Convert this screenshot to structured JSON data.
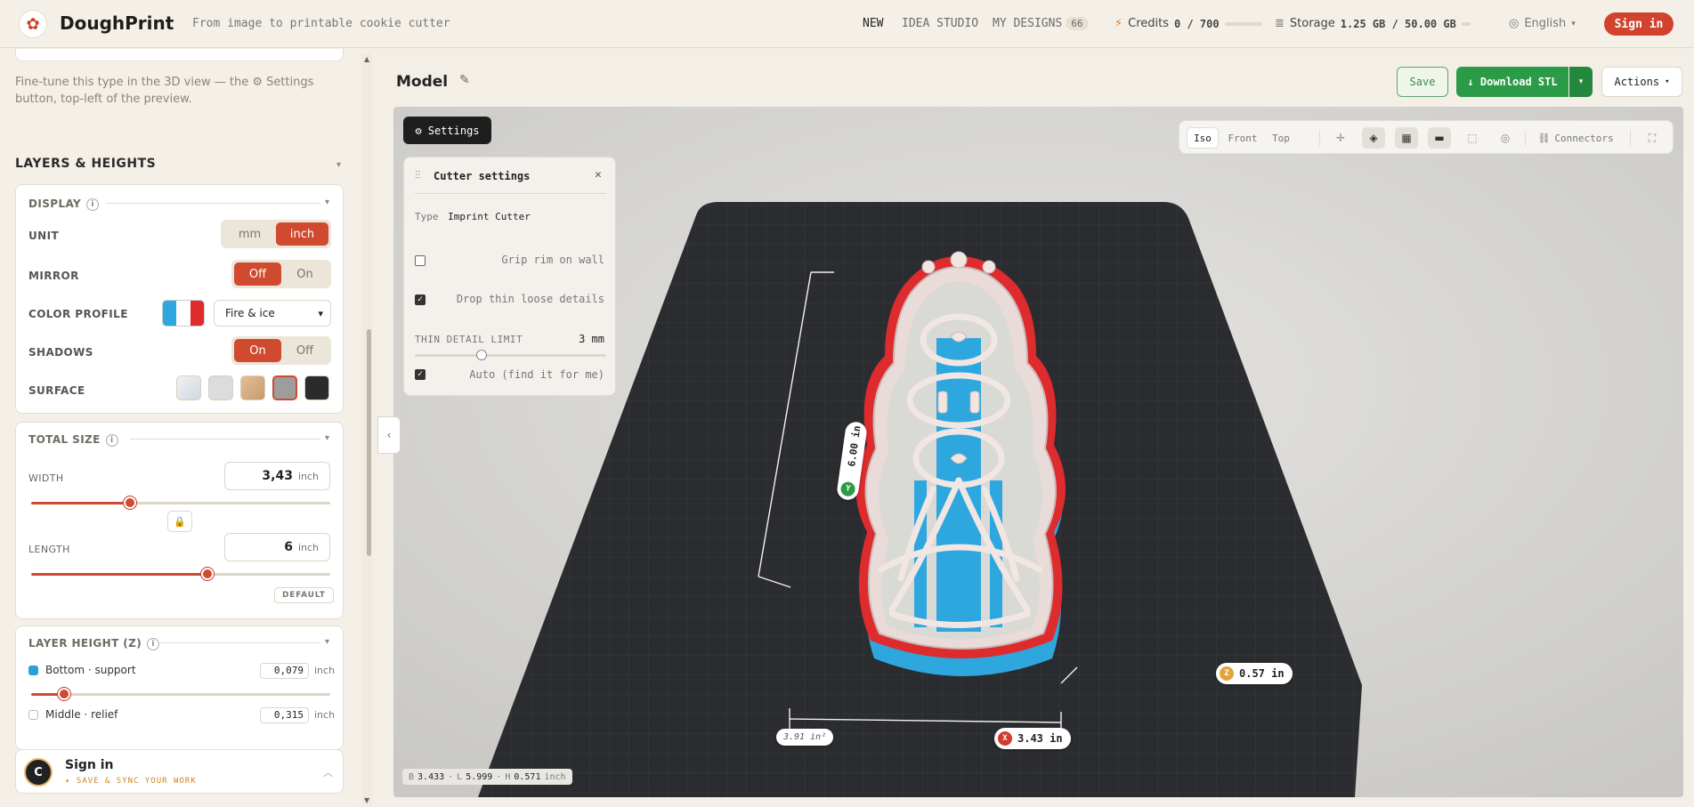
{
  "header": {
    "brand": "DoughPrint",
    "tagline": "From image to printable cookie cutter",
    "nav": [
      {
        "label": "NEW"
      },
      {
        "label": "IDEA STUDIO"
      },
      {
        "label": "MY DESIGNS",
        "count": "66"
      }
    ],
    "credits_label": "Credits",
    "credits_value": "0 / 700",
    "storage_label": "Storage",
    "storage_value": "1.25 GB / 50.00 GB",
    "language": "English",
    "signin": "Sign in"
  },
  "sidebar": {
    "hint": "Fine-tune this type in the 3D view — the ⚙ Settings button, top-left of the preview.",
    "section_title": "LAYERS & HEIGHTS",
    "display": {
      "title": "DISPLAY",
      "unit_label": "UNIT",
      "unit_options": [
        "mm",
        "inch"
      ],
      "unit_selected": "inch",
      "mirror_label": "MIRROR",
      "mirror_options": [
        "Off",
        "On"
      ],
      "mirror_selected": "Off",
      "color_profile_label": "COLOR PROFILE",
      "color_profile_value": "Fire & ice",
      "shadows_label": "SHADOWS",
      "shadows_options": [
        "On",
        "Off"
      ],
      "shadows_selected": "On",
      "surface_label": "SURFACE",
      "surface_colors": [
        "#dfe4ea",
        "#dcdcdc",
        "#d8b48e",
        "#9d9d9d",
        "#2b2b2b"
      ],
      "surface_selected_index": 3
    },
    "total_size": {
      "title": "TOTAL SIZE",
      "width_label": "WIDTH",
      "width_value": "3,43",
      "width_unit": "inch",
      "width_slider_fraction": 0.33,
      "length_label": "LENGTH",
      "length_value": "6",
      "length_unit": "inch",
      "length_slider_fraction": 0.59,
      "default_button": "DEFAULT"
    },
    "layer_height": {
      "title": "LAYER HEIGHT (Z)",
      "layers": [
        {
          "name": "Bottom · support",
          "value": "0,079",
          "unit": "inch",
          "color": "#2ba0d8",
          "checked": true,
          "slider_fraction": 0.11
        },
        {
          "name": "Middle · relief",
          "value": "0,315",
          "unit": "inch",
          "color": "#ffffff",
          "checked": false
        }
      ]
    },
    "signin_card": {
      "avatar": "C",
      "title": "Sign in",
      "subtitle": "SAVE & SYNC YOUR WORK"
    }
  },
  "main": {
    "title": "Model",
    "save": "Save",
    "download": "↓ Download STL",
    "actions": "Actions"
  },
  "viewport": {
    "settings_button": "Settings",
    "cutter_settings": {
      "title": "Cutter settings",
      "type_label": "Type",
      "type_value": "Imprint Cutter",
      "grip_rim": "Grip rim on wall",
      "grip_rim_checked": false,
      "drop_thin": "Drop thin loose details",
      "drop_thin_checked": true,
      "thin_limit_label": "THIN DETAIL LIMIT",
      "thin_limit_value": "3 mm",
      "thin_limit_fraction": 0.35,
      "auto_label": "Auto (find it for me)",
      "auto_checked": true
    },
    "toolbar": {
      "views": [
        "Iso",
        "Front",
        "Top"
      ],
      "active_view": "Iso",
      "icons": [
        "axes-icon",
        "layers-icon",
        "grid-icon",
        "ruler-icon",
        "bounds-icon",
        "globe-icon"
      ],
      "connectors": "Connectors"
    },
    "dimensions": {
      "length": "6.00 in",
      "width": "3.43 in",
      "height": "0.57 in",
      "area": "3.91 in²"
    },
    "status": {
      "b_label": "B",
      "b_value": "3.433",
      "l_label": "L",
      "l_value": "5.999",
      "h_label": "H",
      "h_value": "0.571",
      "unit": "inch"
    },
    "colors": {
      "plate": "#2b2c2f",
      "outer_layer": "#dd2b2e",
      "base_layer": "#2ea6de",
      "walls": "#e9dcd8"
    }
  }
}
